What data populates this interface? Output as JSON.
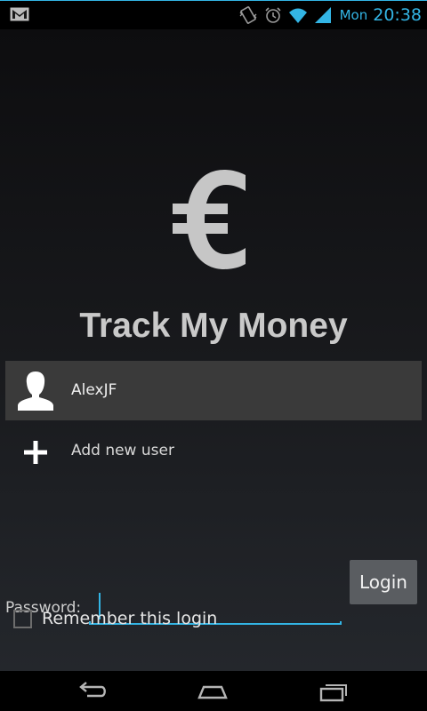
{
  "status_bar": {
    "day": "Mon",
    "time": "20:38",
    "icons": [
      "gmail-icon",
      "vibrate-icon",
      "alarm-icon",
      "wifi-icon",
      "signal-icon"
    ],
    "accent_color": "#33b5e5"
  },
  "app": {
    "title": "Track My Money",
    "logo_symbol": "€",
    "users": [
      {
        "name": "AlexJF"
      }
    ],
    "add_user_label": "Add new user"
  },
  "login": {
    "password_label": "Password:",
    "password_value": "",
    "login_button": "Login",
    "remember_label": "Remember this login",
    "remember_checked": false
  },
  "nav_bar": {
    "buttons": [
      "back-icon",
      "home-icon",
      "recent-apps-icon"
    ]
  }
}
